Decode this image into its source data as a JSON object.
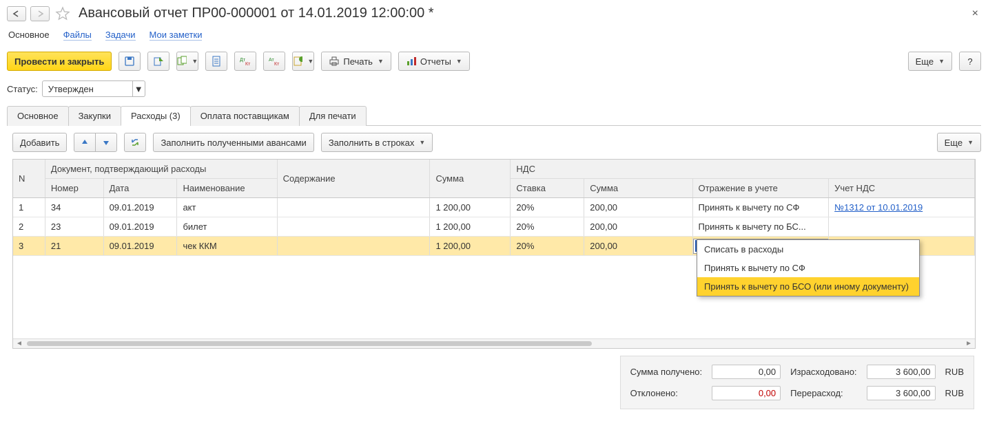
{
  "header": {
    "title": "Авансовый отчет ПР00-000001 от 14.01.2019 12:00:00 *"
  },
  "nav": {
    "main": "Основное",
    "files": "Файлы",
    "tasks": "Задачи",
    "notes": "Мои заметки"
  },
  "toolbar": {
    "post_close": "Провести и закрыть",
    "print": "Печать",
    "reports": "Отчеты",
    "more": "Еще",
    "help": "?"
  },
  "status": {
    "label": "Статус:",
    "value": "Утвержден"
  },
  "tabs": {
    "main": "Основное",
    "purchases": "Закупки",
    "expenses": "Расходы (3)",
    "payments": "Оплата поставщикам",
    "print": "Для печати"
  },
  "tabToolbar": {
    "add": "Добавить",
    "fill_adv": "Заполнить полученными авансами",
    "fill_rows": "Заполнить в строках",
    "more": "Еще"
  },
  "columns": {
    "n": "N",
    "doc_group": "Документ, подтверждающий расходы",
    "number": "Номер",
    "date": "Дата",
    "name": "Наименование",
    "content": "Содержание",
    "sum": "Сумма",
    "nds_group": "НДС",
    "rate": "Ставка",
    "nds_sum": "Сумма",
    "accounting": "Отражение в учете",
    "nds_acc": "Учет НДС"
  },
  "rows": [
    {
      "n": "1",
      "number": "34",
      "date": "09.01.2019",
      "name": "акт",
      "content": "",
      "sum": "1 200,00",
      "rate": "20%",
      "nds_sum": "200,00",
      "acc": "Принять к вычету по СФ",
      "nds_link": "№1312 от 10.01.2019"
    },
    {
      "n": "2",
      "number": "23",
      "date": "09.01.2019",
      "name": "билет",
      "content": "",
      "sum": "1 200,00",
      "rate": "20%",
      "nds_sum": "200,00",
      "acc": "Принять к вычету по БС...",
      "nds_link": ""
    },
    {
      "n": "3",
      "number": "21",
      "date": "09.01.2019",
      "name": "чек ККМ",
      "content": "",
      "sum": "1 200,00",
      "rate": "20%",
      "nds_sum": "200,00",
      "acc": "Списать в расходы",
      "nds_link": ""
    }
  ],
  "dropdown": {
    "opt1": "Списать в расходы",
    "opt2": "Принять к вычету по СФ",
    "opt3": "Принять к вычету по БСО (или иному документу)"
  },
  "footer": {
    "received_lbl": "Сумма получено:",
    "received_val": "0,00",
    "spent_lbl": "Израсходовано:",
    "spent_val": "3 600,00",
    "declined_lbl": "Отклонено:",
    "declined_val": "0,00",
    "over_lbl": "Перерасход:",
    "over_val": "3 600,00",
    "cur": "RUB"
  }
}
